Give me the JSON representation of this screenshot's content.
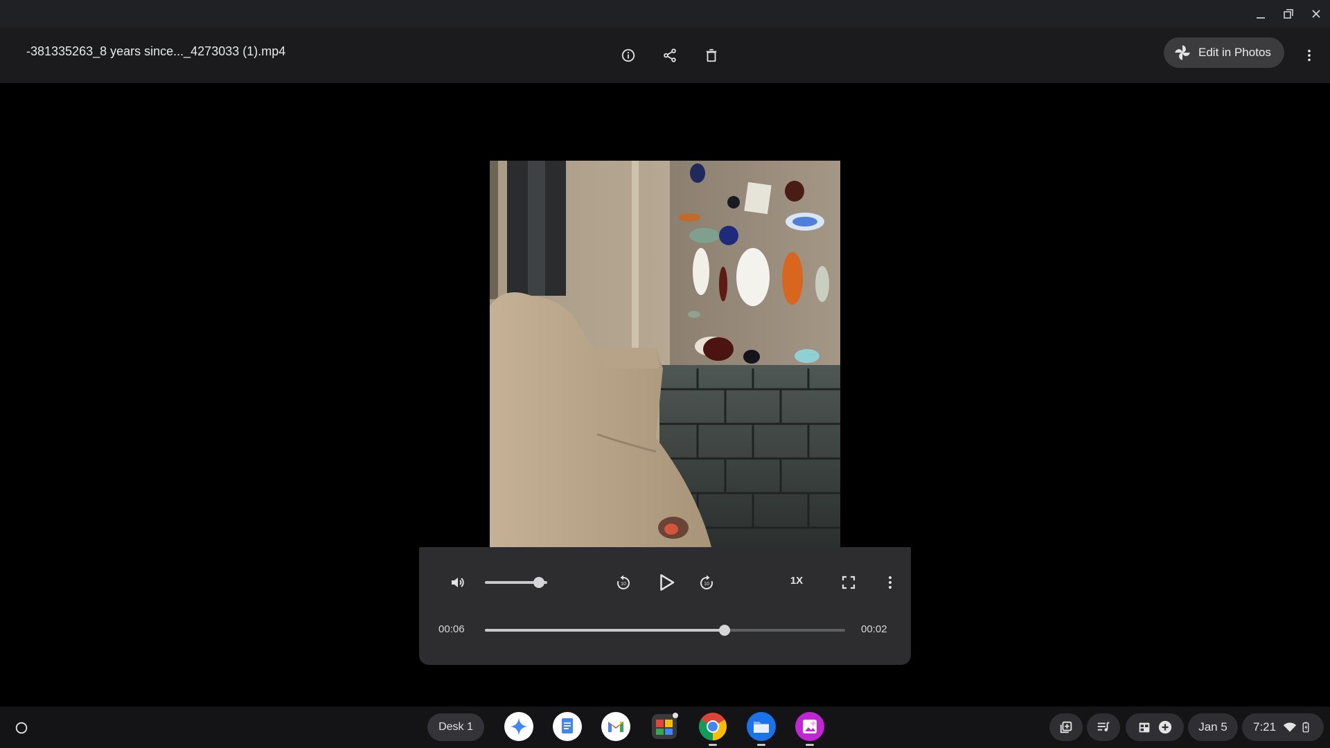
{
  "window": {
    "controls": [
      "minimize-icon",
      "restore-icon",
      "close-icon"
    ]
  },
  "header": {
    "file_name": "-381335263_8 years since..._4273033 (1).mp4",
    "actions": [
      "info-icon",
      "share-icon",
      "delete-icon"
    ],
    "edit_button_label": "Edit in Photos",
    "more_icon": "more-vert-icon"
  },
  "player": {
    "volume_level": 0.78,
    "speed_label": "1X",
    "current_time": "00:06",
    "remaining_time": "00:02",
    "progress": 0.665
  },
  "shelf": {
    "desk_label": "Desk 1",
    "apps": [
      "gemini",
      "docs",
      "gmail",
      "photos-collage",
      "chrome",
      "files",
      "gallery"
    ],
    "date": "Jan 5",
    "time": "7:21"
  },
  "colors": {
    "background": "#000000",
    "header": "#1b1b1d",
    "controls_panel": "#2d2d30",
    "shelf": "#141416",
    "edit_button": "#3c3c3f"
  }
}
